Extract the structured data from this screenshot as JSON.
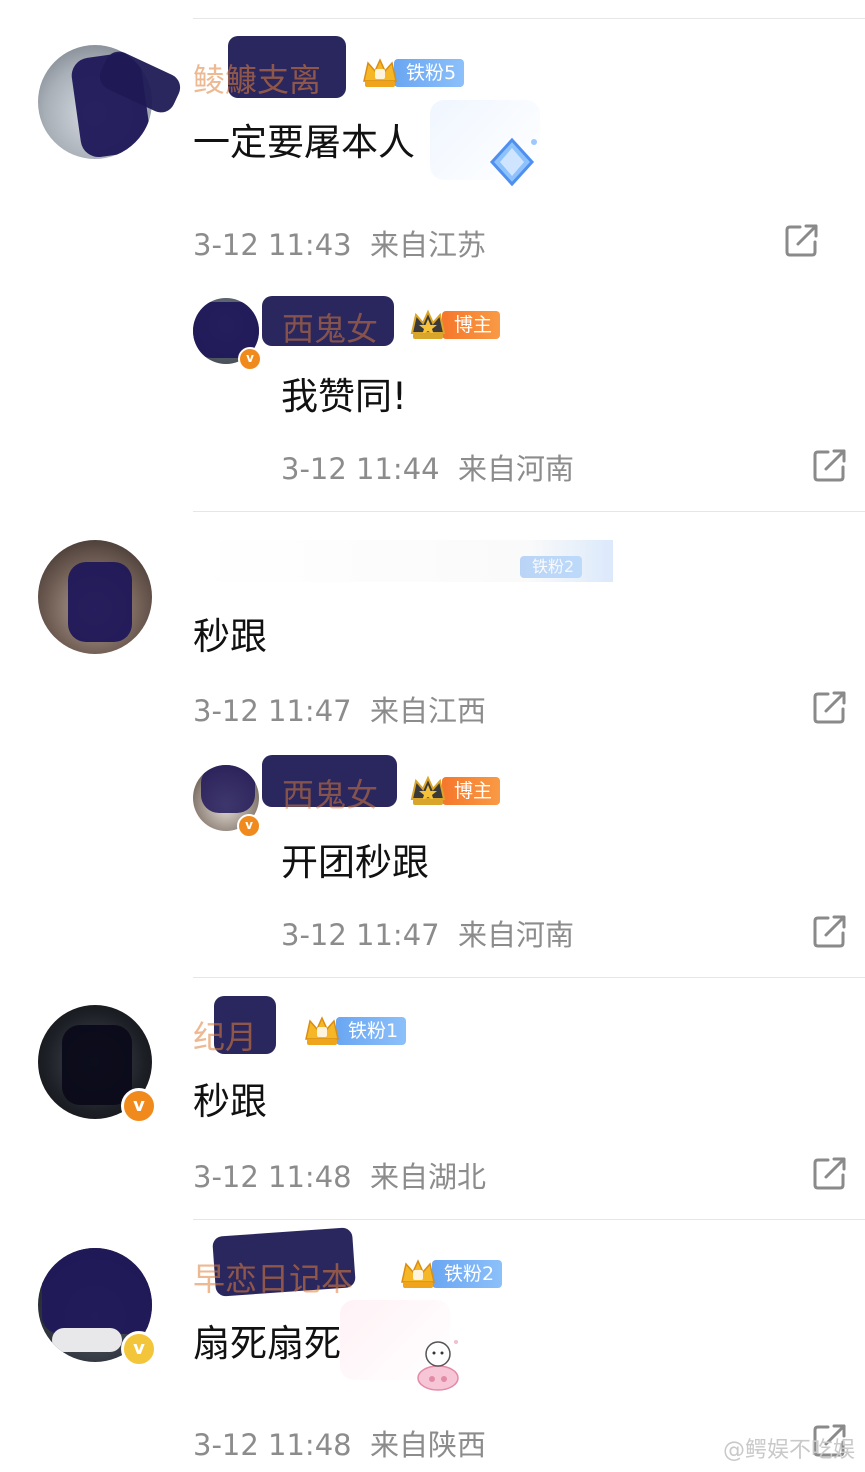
{
  "comments": [
    {
      "name": "鲮鱇支离",
      "fan_badge": "铁粉5",
      "text": "一定要屠本人",
      "time": "3-12 11:43",
      "location": "来自江苏",
      "reply": {
        "name": "西鬼女",
        "badge": "博主",
        "text": "我赞同!",
        "time": "3-12 11:44",
        "location": "来自河南"
      }
    },
    {
      "name": "",
      "fan_badge": "铁粉2",
      "text": "秒跟",
      "time": "3-12 11:47",
      "location": "来自江西",
      "reply": {
        "name": "西鬼女",
        "badge": "博主",
        "text": "开团秒跟",
        "time": "3-12 11:47",
        "location": "来自河南"
      }
    },
    {
      "name": "纪月",
      "fan_badge": "铁粉1",
      "text": "秒跟",
      "time": "3-12 11:48",
      "location": "来自湖北"
    },
    {
      "name": "早恋日记本",
      "fan_badge": "铁粉2",
      "text": "扇死扇死",
      "time": "3-12 11:48",
      "location": "来自陕西"
    }
  ],
  "verified_mark": "v",
  "watermark": "@鳄娱不吃娱",
  "colors": {
    "username": "#e0803a",
    "fan_badge": "#7ab3f6",
    "blogger_badge": "#f7862f",
    "meta_text": "#8c8c8c",
    "divider": "#e6e6e6"
  },
  "icons": [
    "share-icon",
    "crown-icon",
    "verified-icon"
  ]
}
